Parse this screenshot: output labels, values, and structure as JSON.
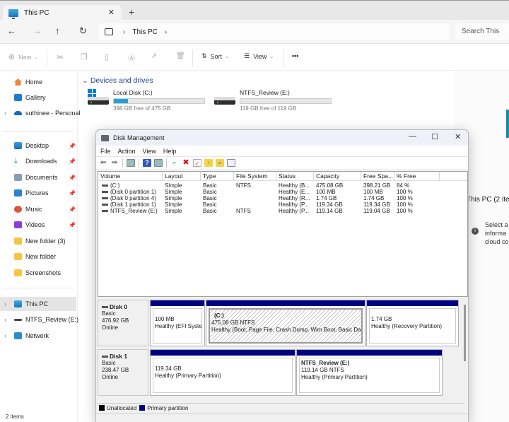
{
  "explorer": {
    "tab_title": "This PC",
    "nav": {
      "back": "←",
      "forward": "→",
      "up": "↑",
      "refresh": "↻",
      "breadcrumb": [
        "This PC"
      ]
    },
    "search_placeholder": "Search This PC",
    "commands": {
      "new": "New",
      "sort": "Sort",
      "view": "View",
      "more": "•••"
    },
    "sidebar": {
      "items": [
        {
          "label": "Home",
          "icon": "home-icon"
        },
        {
          "label": "Gallery",
          "icon": "gallery-icon"
        },
        {
          "label": "suthinee - Personal",
          "icon": "onedrive-icon"
        },
        {
          "label": "Desktop",
          "icon": "desktop-icon",
          "pinned": true
        },
        {
          "label": "Downloads",
          "icon": "downloads-icon",
          "pinned": true
        },
        {
          "label": "Documents",
          "icon": "documents-icon",
          "pinned": true
        },
        {
          "label": "Pictures",
          "icon": "pictures-icon",
          "pinned": true
        },
        {
          "label": "Music",
          "icon": "music-icon",
          "pinned": true
        },
        {
          "label": "Videos",
          "icon": "videos-icon",
          "pinned": true
        },
        {
          "label": "New folder (3)",
          "icon": "folder-icon"
        },
        {
          "label": "New folder",
          "icon": "folder-icon"
        },
        {
          "label": "Screenshots",
          "icon": "folder-icon"
        },
        {
          "label": "This PC",
          "icon": "this-pc-icon",
          "selected": true
        },
        {
          "label": "NTFS_Review (E:)",
          "icon": "drive-icon"
        },
        {
          "label": "Network",
          "icon": "network-icon"
        }
      ]
    },
    "section_title": "Devices and drives",
    "drives": [
      {
        "name": "Local Disk (C:)",
        "free_text": "398 GB free of 475 GB",
        "used_fraction": 0.16
      },
      {
        "name": "NTFS_Review (E:)",
        "free_text": "119 GB free of 119 GB",
        "used_fraction": 0.0
      }
    ],
    "status": "2 items",
    "details_pane": {
      "title": "This PC (2 ite",
      "info_lines": [
        "Select a",
        "informa",
        "cloud co"
      ]
    }
  },
  "disk_management": {
    "title": "Disk Management",
    "menu": [
      "File",
      "Action",
      "View",
      "Help"
    ],
    "columns": [
      "Volume",
      "Layout",
      "Type",
      "File System",
      "Status",
      "Capacity",
      "Free Spa...",
      "% Free"
    ],
    "volumes": [
      [
        "(C:)",
        "Simple",
        "Basic",
        "NTFS",
        "Healthy (B...",
        "475.08 GB",
        "398.21 GB",
        "84 %"
      ],
      [
        "(Disk 0 partition 1)",
        "Simple",
        "Basic",
        "",
        "Healthy (E...",
        "100 MB",
        "100 MB",
        "100 %"
      ],
      [
        "(Disk 0 partition 4)",
        "Simple",
        "Basic",
        "",
        "Healthy (R...",
        "1.74 GB",
        "1.74 GB",
        "100 %"
      ],
      [
        "(Disk 1 partition 1)",
        "Simple",
        "Basic",
        "",
        "Healthy (P...",
        "119.34 GB",
        "119.34 GB",
        "100 %"
      ],
      [
        "NTFS_Review (E:)",
        "Simple",
        "Basic",
        "NTFS",
        "Healthy (P...",
        "119.14 GB",
        "119.04 GB",
        "100 %"
      ]
    ],
    "disks": [
      {
        "name": "Disk 0",
        "type": "Basic",
        "size": "476.92 GB",
        "state": "Online",
        "partitions": [
          {
            "label": "",
            "size": "100 MB",
            "status": "Healthy (EFI Syster"
          },
          {
            "label": "(C:)",
            "size": "475.08 GB NTFS",
            "status": "Healthy (Boot, Page File, Crash Dump, Wim Boot, Basic Da"
          },
          {
            "label": "",
            "size": "1.74 GB",
            "status": "Healthy (Recovery Partition)"
          }
        ]
      },
      {
        "name": "Disk 1",
        "type": "Basic",
        "size": "238.47 GB",
        "state": "Online",
        "partitions": [
          {
            "label": "",
            "size": "119.34 GB",
            "status": "Healthy (Primary Partition)"
          },
          {
            "label": "NTFS_Review  (E:)",
            "size": "119.14 GB NTFS",
            "status": "Healthy (Primary Partition)"
          }
        ]
      }
    ],
    "legend": [
      {
        "label": "Unallocated",
        "color": "#000000"
      },
      {
        "label": "Primary partition",
        "color": "#000080"
      }
    ]
  }
}
